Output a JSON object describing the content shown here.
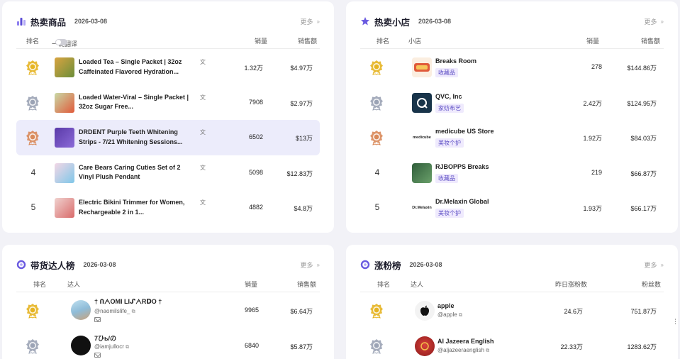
{
  "hot_products": {
    "title": "热卖商品",
    "date": "2026-03-08",
    "more": "更多",
    "columns": {
      "rank": "排名",
      "translate": "一键翻译",
      "sales": "销量",
      "revenue": "销售额"
    },
    "rows": [
      {
        "rank": "1",
        "name": "Loaded Tea – Single Packet | 32oz Caffeinated Flavored Hydration...",
        "sales": "1.32万",
        "revenue": "$4.97万"
      },
      {
        "rank": "2",
        "name": "Loaded Water-Viral – Single Packet | 32oz Sugar Free...",
        "sales": "7908",
        "revenue": "$2.97万"
      },
      {
        "rank": "3",
        "name": "DRDENT Purple Teeth Whitening Strips - 7/21 Whitening Sessions...",
        "sales": "6502",
        "revenue": "$13万"
      },
      {
        "rank": "4",
        "name": "Care Bears Caring Cuties Set of 2 Vinyl Plush Pendant",
        "sales": "5098",
        "revenue": "$12.83万"
      },
      {
        "rank": "5",
        "name": "Electric Bikini Trimmer for Women, Rechargeable 2 in 1...",
        "sales": "4882",
        "revenue": "$4.8万"
      }
    ]
  },
  "hot_shops": {
    "title": "热卖小店",
    "date": "2026-03-08",
    "more": "更多",
    "columns": {
      "rank": "排名",
      "shop": "小店",
      "sales": "销量",
      "revenue": "销售额"
    },
    "rows": [
      {
        "rank": "1",
        "name": "Breaks Room",
        "tag": "收藏品",
        "sales": "278",
        "revenue": "$144.86万"
      },
      {
        "rank": "2",
        "name": "QVC, Inc",
        "tag": "家纺布艺",
        "sales": "2.42万",
        "revenue": "$124.95万"
      },
      {
        "rank": "3",
        "name": "medicube US Store",
        "tag": "美妆个护",
        "sales": "1.92万",
        "revenue": "$84.03万",
        "logo_text": "medicube"
      },
      {
        "rank": "4",
        "name": "RJBOPPS Breaks",
        "tag": "收藏品",
        "sales": "219",
        "revenue": "$66.87万"
      },
      {
        "rank": "5",
        "name": "Dr.Melaxin Global",
        "tag": "美妆个护",
        "sales": "1.93万",
        "revenue": "$66.17万",
        "logo_text": "Dr.Melaxin"
      }
    ]
  },
  "creators": {
    "title": "带货达人榜",
    "date": "2026-03-08",
    "more": "更多",
    "columns": {
      "rank": "排名",
      "creator": "达人",
      "sales": "销量",
      "revenue": "销售额"
    },
    "rows": [
      {
        "rank": "1",
        "name": "† ՈᗅOMI LI﻿ᔑᗅRᗞO †",
        "handle": "@naomilslife_",
        "sales": "9965",
        "revenue": "$6.64万"
      },
      {
        "rank": "2",
        "name": "7ひь/の",
        "handle": "@iamjullocr",
        "sales": "6840",
        "revenue": "$5.87万"
      }
    ]
  },
  "followers": {
    "title": "涨粉榜",
    "date": "2026-03-08",
    "more": "更多",
    "columns": {
      "rank": "排名",
      "creator": "达人",
      "yesterday": "昨日涨粉数",
      "fans": "粉丝数"
    },
    "rows": [
      {
        "rank": "1",
        "name": "apple",
        "handle": "@apple",
        "yesterday": "24.6万",
        "fans": "751.87万"
      },
      {
        "rank": "2",
        "name": "Al Jazeera English",
        "handle": "@aljazeeraenglish",
        "yesterday": "22.33万",
        "fans": "1283.62万"
      }
    ]
  },
  "colors": {
    "accent": "#6a5ae0",
    "highlight_row": "#ececfb",
    "gold": "#e6b422",
    "silver": "#9ba3b5",
    "bronze": "#d98a5a"
  }
}
